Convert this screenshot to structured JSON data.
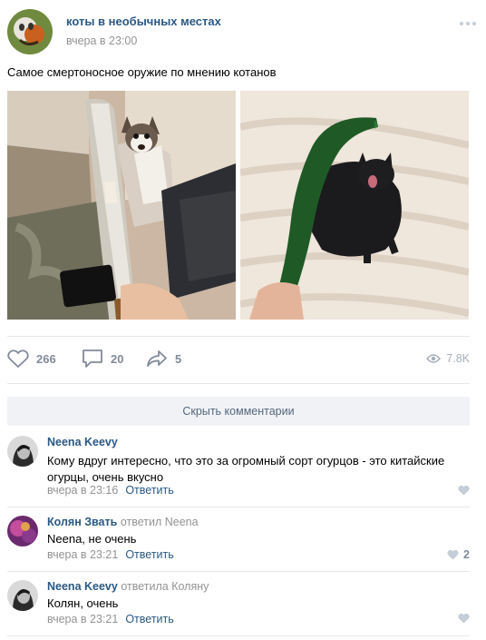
{
  "post": {
    "group_name": "коты в необычных местах",
    "time": "вчера в 23:00",
    "text": "Самое смертоносное оружие по мнению котанов",
    "photos": [
      "cat-with-machete-photo",
      "black-cat-with-cucumber-photo"
    ],
    "likes": "266",
    "comments": "20",
    "shares": "5",
    "views": "7.8K"
  },
  "hide_comments_label": "Скрыть комментарии",
  "comments": [
    {
      "author": "Neena Keevy",
      "replied": "",
      "reply_to": "",
      "text": "Кому вдруг интересно, что это за огромный сорт огурцов - это китайские огурцы, очень вкусно",
      "date": "вчера в 23:16",
      "reply_label": "Ответить",
      "likes": ""
    },
    {
      "author": "Колян Звать",
      "replied": "ответил",
      "reply_to": "Neena",
      "text": "Neena, не очень",
      "date": "вчера в 23:21",
      "reply_label": "Ответить",
      "likes": "2"
    },
    {
      "author": "Neena Keevy",
      "replied": "ответила",
      "reply_to": "Коляну",
      "text": "Колян, очень",
      "date": "вчера в 23:21",
      "reply_label": "Ответить",
      "likes": ""
    }
  ],
  "colors": {
    "link": "#2a5885",
    "secondary": "#939393",
    "icon": "#828a99",
    "button_bg": "#f0f2f5"
  }
}
